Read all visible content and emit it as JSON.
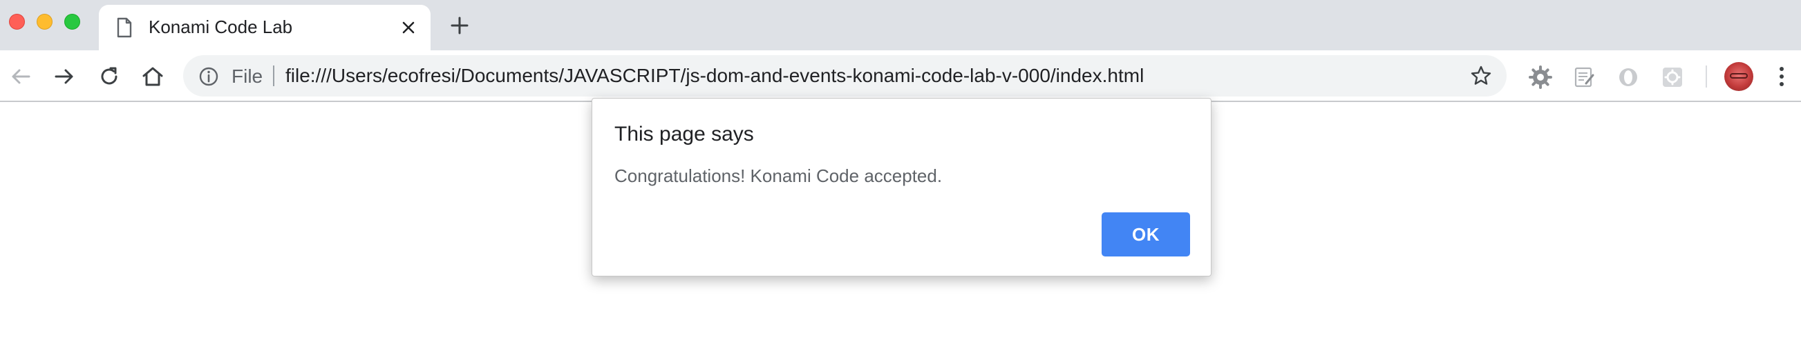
{
  "window": {
    "traffic_lights": {
      "close": "#fe5f57",
      "minimize": "#febc2e",
      "maximize": "#28c840"
    }
  },
  "tab": {
    "title": "Konami Code Lab",
    "icon": "document-icon",
    "close_icon": "close-icon"
  },
  "new_tab_icon": "plus-icon",
  "toolbar": {
    "back_icon": "back-arrow-icon",
    "forward_icon": "forward-arrow-icon",
    "reload_icon": "reload-icon",
    "home_icon": "home-icon"
  },
  "omnibox": {
    "info_icon": "info-icon",
    "scheme_label": "File",
    "url": "file:///Users/ecofresi/Documents/JAVASCRIPT/js-dom-and-events-konami-code-lab-v-000/index.html",
    "bookmark_icon": "star-icon"
  },
  "extensions": [
    "gear-extension-icon",
    "notes-extension-icon",
    "opera-extension-icon",
    "gear-box-extension-icon"
  ],
  "profile": {
    "avatar": "avatar"
  },
  "menu_icon": "kebab-menu-icon",
  "dialog": {
    "title": "This page says",
    "message": "Congratulations! Konami Code accepted.",
    "ok_label": "OK",
    "ok_color": "#4285f4"
  }
}
